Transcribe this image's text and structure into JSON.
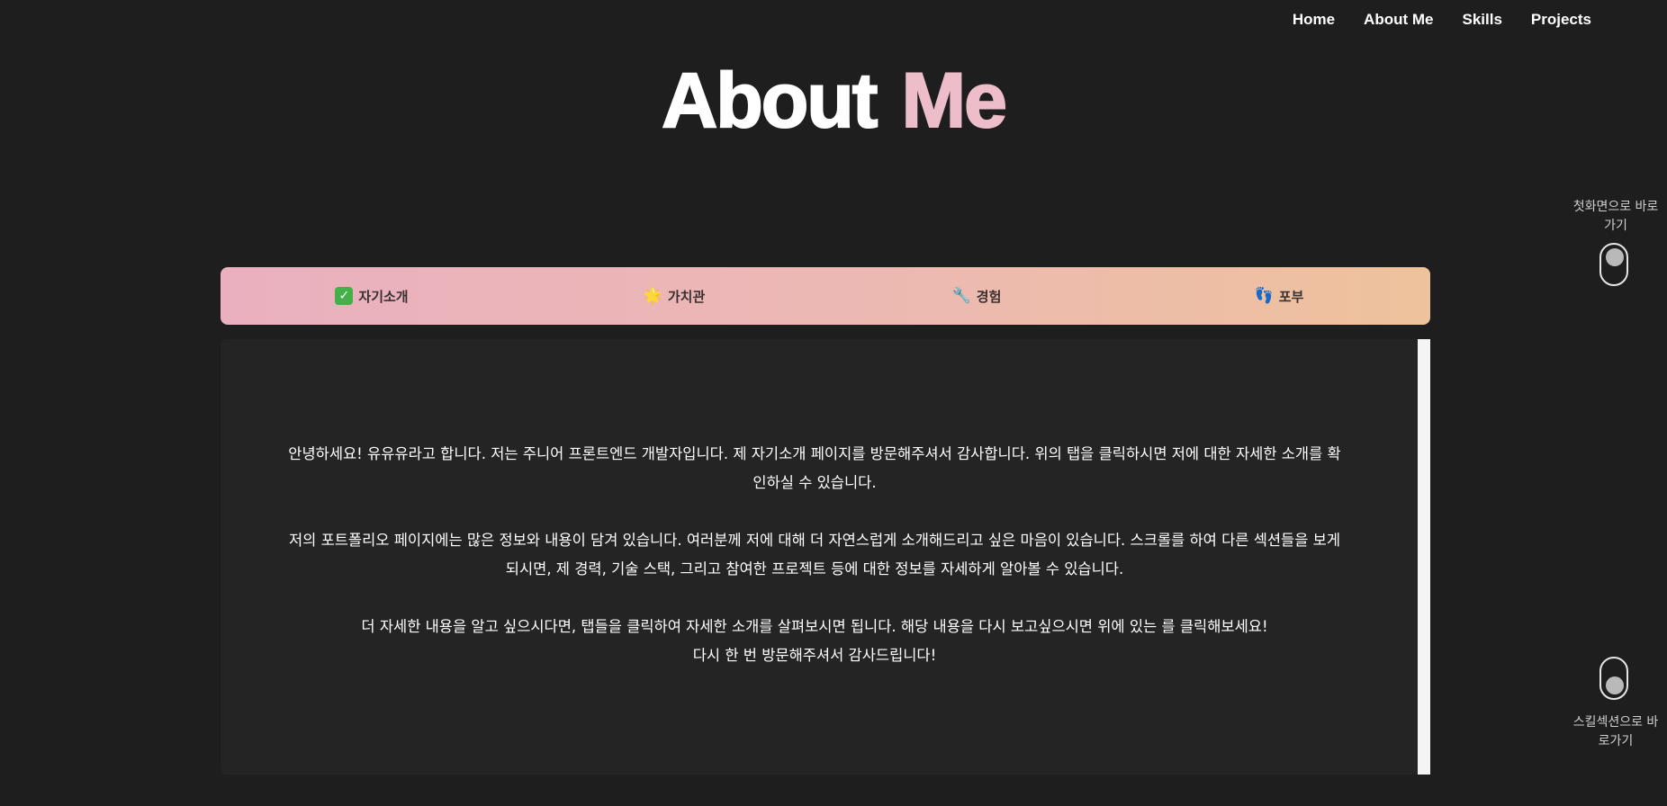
{
  "nav": {
    "items": [
      "Home",
      "About Me",
      "Skills",
      "Projects"
    ]
  },
  "title": {
    "part1": "About",
    "part2": "Me",
    "accent_color": "#eebdca"
  },
  "tabs": [
    {
      "icon": "check-mark-icon",
      "glyph": "✓",
      "label": "자기소개"
    },
    {
      "icon": "glowing-star-icon",
      "glyph": "🌟",
      "label": "가치관"
    },
    {
      "icon": "wrench-icon",
      "glyph": "🔧",
      "label": "경험"
    },
    {
      "icon": "footprints-icon",
      "glyph": "👣",
      "label": "포부"
    }
  ],
  "content": {
    "paragraphs": [
      "안녕하세요! 유유유라고 합니다. 저는 주니어 프론트엔드 개발자입니다. 제 자기소개 페이지를 방문해주셔서 감사합니다. 위의 탭을 클릭하시면 저에 대한 자세한 소개를 확인하실 수 있습니다.",
      "저의 포트폴리오 페이지에는 많은 정보와 내용이 담겨 있습니다. 여러분께 저에 대해 더 자연스럽게 소개해드리고 싶은 마음이 있습니다. 스크롤를 하여 다른 섹션들을 보게 되시면, 제 경력, 기술 스택, 그리고 참여한 프로젝트 등에 대한 정보를 자세하게 알아볼 수 있습니다.",
      "더 자세한 내용을 알고 싶으시다면, 탭들을 클릭하여 자세한 소개를 살펴보시면 됩니다. 해당 내용을 다시 보고싶으시면 위에 있는 를 클릭해보세요!",
      "다시 한 번 방문해주셔서 감사드립니다!"
    ]
  },
  "shortcuts": {
    "top_label": "첫화면으로 바로가기",
    "bottom_label": "스킬섹션으로 바로가기"
  },
  "colors": {
    "background": "#1e1e1e",
    "panel": "#242424",
    "tab_gradient_start": "#eab0bf",
    "tab_gradient_end": "#eec29c"
  }
}
